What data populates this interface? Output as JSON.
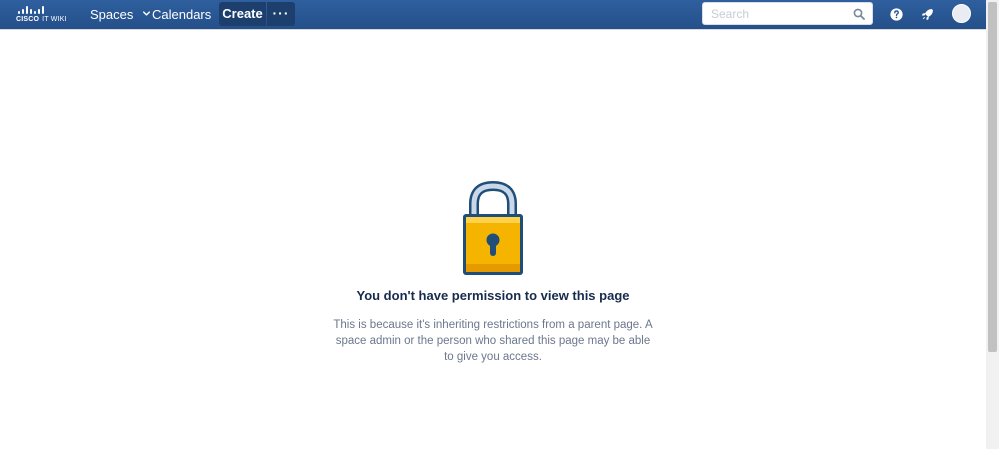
{
  "header": {
    "logo": {
      "brand": "CISCO",
      "product": "IT WIKI"
    },
    "nav": {
      "spaces_label": "Spaces",
      "calendars_label": "Calendars"
    },
    "create_label": "Create",
    "more_label": "···",
    "search": {
      "placeholder": "Search",
      "value": ""
    }
  },
  "message": {
    "title": "You don't have permission to view this page",
    "description": "This is because it's inheriting restrictions from a parent page. A space admin or the person who shared this page may be able to give you access."
  },
  "colors": {
    "header_bg": "#2a5a99",
    "create_bg": "#1c3f6e",
    "lock_body": "#f5b400",
    "lock_outline": "#1f4e79",
    "title_text": "#172b4d",
    "desc_text": "#6b778c"
  },
  "icons": {
    "search": "search-icon",
    "help": "help-icon",
    "notifications": "rocket-icon",
    "avatar": "avatar",
    "lock": "padlock-icon"
  }
}
